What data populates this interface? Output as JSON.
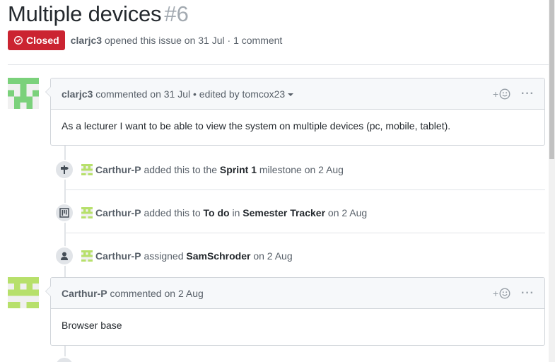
{
  "issue": {
    "title": "Multiple devices",
    "number": "#6",
    "state": "Closed",
    "author": "clarjc3",
    "opened_text": "opened this issue on 31 Jul · 1 comment"
  },
  "comments": [
    {
      "author": "clarjc3",
      "action": "commented on 31 Jul",
      "edited": "• edited by tomcox23",
      "body": "As a lecturer I want to be able to view the system on multiple devices (pc, mobile, tablet).",
      "reaction_icon": "smiley-icon",
      "menu": "···"
    },
    {
      "author": "Carthur-P",
      "action": "commented on 2 Aug",
      "body": "Browser base",
      "reaction_icon": "smiley-icon",
      "menu": "···"
    }
  ],
  "events": [
    {
      "icon": "milestone-icon",
      "actor": "Carthur-P",
      "text1": "added this to the",
      "target": "Sprint 1",
      "text2": "milestone on 2 Aug"
    },
    {
      "icon": "project-icon",
      "actor": "Carthur-P",
      "text1": "added this to",
      "target": "To do",
      "text2": "in",
      "target2": "Semester Tracker",
      "text3": "on 2 Aug"
    },
    {
      "icon": "person-icon",
      "actor": "Carthur-P",
      "text1": "assigned",
      "target": "SamSchroder",
      "text2": "on 2 Aug"
    }
  ],
  "colors": {
    "closed_red": "#cb2431",
    "avatar_green": "#7bd17b",
    "avatar_lime": "#b7e06b"
  }
}
